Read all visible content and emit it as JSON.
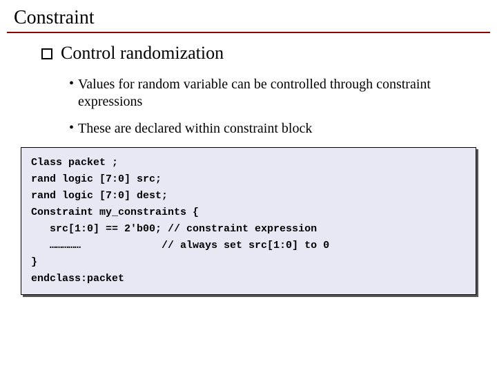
{
  "title": "Constraint",
  "heading": "Control randomization",
  "bullets": [
    "Values for random variable can be controlled through constraint expressions",
    "These are declared within constraint block"
  ],
  "code": {
    "line1": "Class packet ;",
    "line2": "rand logic [7:0] src;",
    "line3": "rand logic [7:0] dest;",
    "line4": "Constraint my_constraints {",
    "line5": "   src[1:0] == 2'b00; // constraint expression",
    "line6": "   ……………             // always set src[1:0] to 0",
    "line7": "}",
    "line8": "endclass:packet"
  }
}
